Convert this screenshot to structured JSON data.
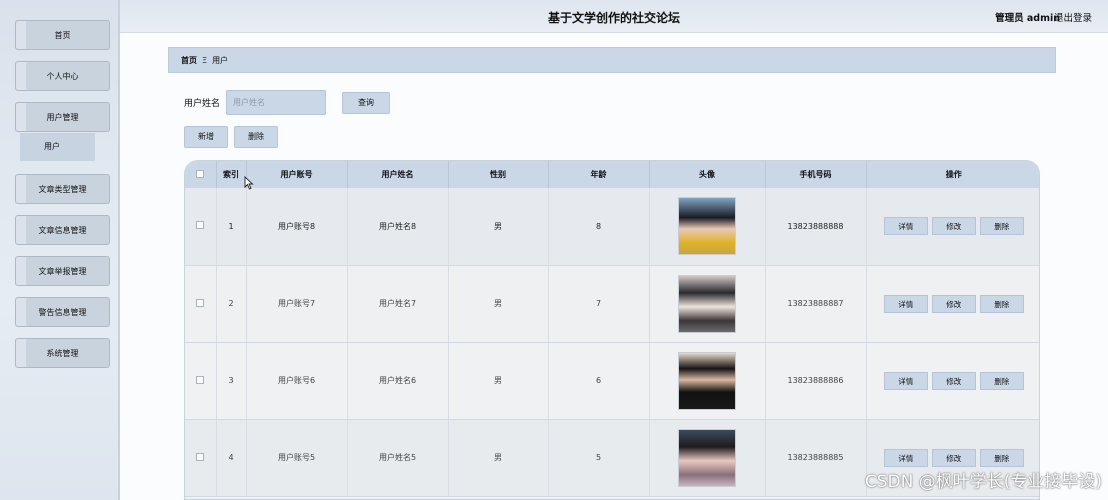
{
  "header": {
    "title": "基于文学创作的社交论坛",
    "user": "管理员 admin",
    "logout": "退出登录"
  },
  "sidebar": {
    "items": [
      {
        "label": "首页"
      },
      {
        "label": "个人中心"
      },
      {
        "label": "用户管理"
      },
      {
        "label": "文章类型管理"
      },
      {
        "label": "文章信息管理"
      },
      {
        "label": "文章举报管理"
      },
      {
        "label": "警告信息管理"
      },
      {
        "label": "系统管理"
      }
    ],
    "sub_item": "用户"
  },
  "breadcrumb": {
    "home": "首页",
    "sep": "Ξ",
    "current": "用户"
  },
  "search": {
    "label": "用户姓名",
    "placeholder": "用户姓名",
    "query_button": "查询"
  },
  "actions": {
    "add": "新增",
    "delete": "删除"
  },
  "table": {
    "columns": [
      "",
      "索引",
      "用户账号",
      "用户姓名",
      "性别",
      "年龄",
      "头像",
      "手机号码",
      "操作"
    ],
    "rows": [
      {
        "index": "1",
        "account": "用户账号8",
        "name": "用户姓名8",
        "gender": "男",
        "age": "8",
        "phone": "13823888888"
      },
      {
        "index": "2",
        "account": "用户账号7",
        "name": "用户姓名7",
        "gender": "男",
        "age": "7",
        "phone": "13823888887"
      },
      {
        "index": "3",
        "account": "用户账号6",
        "name": "用户姓名6",
        "gender": "男",
        "age": "6",
        "phone": "13823888886"
      },
      {
        "index": "4",
        "account": "用户账号5",
        "name": "用户姓名5",
        "gender": "男",
        "age": "5",
        "phone": "13823888885"
      }
    ],
    "row_ops": {
      "detail": "详情",
      "edit": "修改",
      "delete": "删除"
    }
  },
  "watermark": "CSDN @枫叶学长(专业接毕设)"
}
